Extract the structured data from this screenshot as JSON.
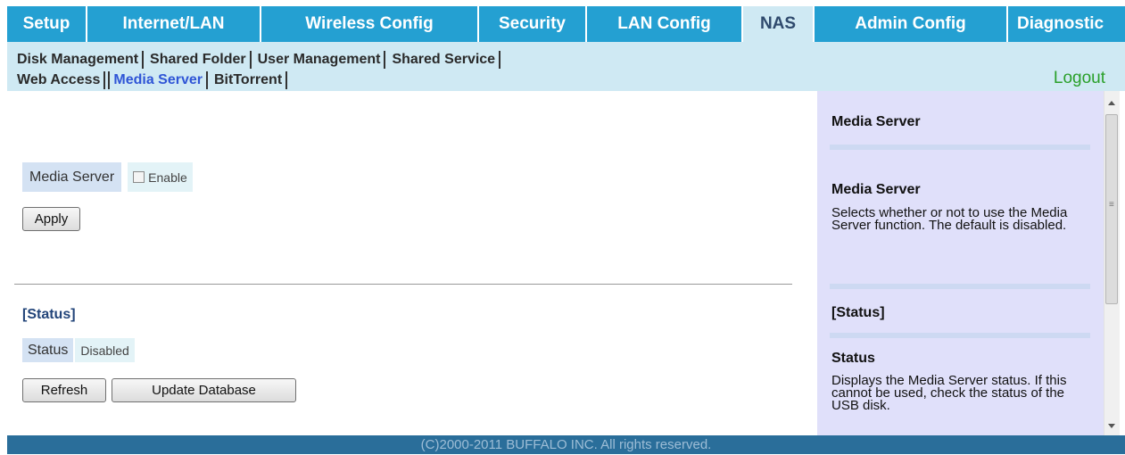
{
  "nav": {
    "tabs": [
      {
        "label": "Setup"
      },
      {
        "label": "Internet/LAN"
      },
      {
        "label": "Wireless Config"
      },
      {
        "label": "Security"
      },
      {
        "label": "LAN Config"
      },
      {
        "label": "NAS"
      },
      {
        "label": "Admin Config"
      },
      {
        "label": "Diagnostic"
      }
    ],
    "active_tab": "NAS"
  },
  "subnav": {
    "row1": [
      "Disk Management",
      "Shared Folder",
      "User Management",
      "Shared Service"
    ],
    "row2": [
      "Web Access",
      "Media Server",
      "BitTorrent"
    ],
    "active": "Media Server",
    "logout": "Logout"
  },
  "main": {
    "media_server_label": "Media Server",
    "enable_label": "Enable",
    "enable_checked": false,
    "apply_button": "Apply",
    "status_section_title": "[Status]",
    "status_label": "Status",
    "status_value": "Disabled",
    "refresh_button": "Refresh",
    "update_db_button": "Update Database"
  },
  "help": {
    "title": "Media Server",
    "entries": [
      {
        "heading": "Media Server",
        "text": "Selects whether or not to use the Media Server function. The default is disabled."
      },
      {
        "heading": "[Status]"
      },
      {
        "heading": "Status",
        "text": "Displays the Media Server status. If this cannot be used, check the status of the USB disk."
      }
    ]
  },
  "footer": {
    "copyright": "(C)2000-2011 BUFFALO INC. All rights reserved."
  },
  "colors": {
    "tab_bg": "#24a0d2",
    "tab_active_bg": "#cfe9f3",
    "subnav_bg": "#cfe9f3",
    "help_bg": "#e0e0fa",
    "footer_bg": "#2a6e9a",
    "logout": "#2aa02a",
    "status_title": "#23457a"
  }
}
